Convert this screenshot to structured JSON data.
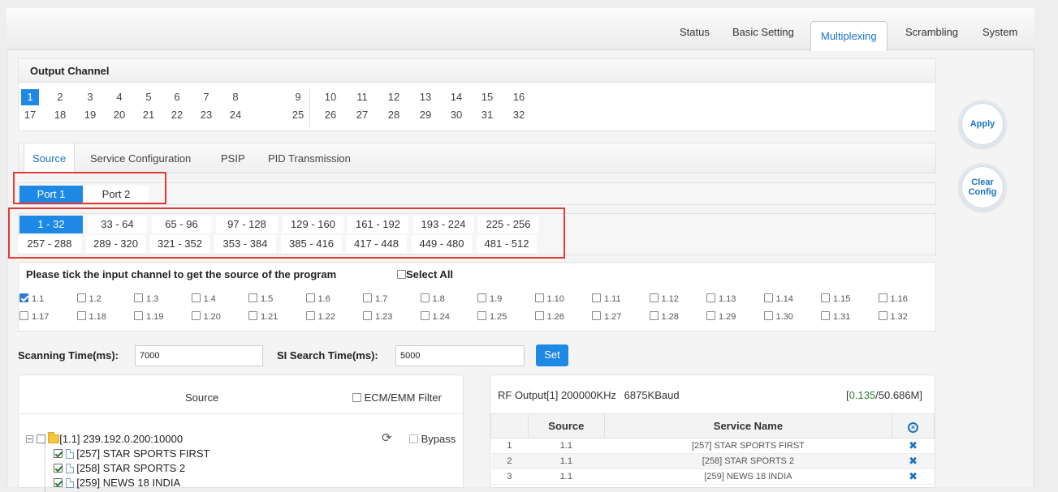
{
  "nav": {
    "tabs": [
      "Status",
      "Basic Setting",
      "Multiplexing",
      "Scrambling",
      "System"
    ],
    "active": "Multiplexing"
  },
  "output_channel": {
    "title": "Output Channel",
    "row1": [
      "1",
      "2",
      "3",
      "4",
      "5",
      "6",
      "7",
      "8",
      "9",
      "10",
      "11",
      "12",
      "13",
      "14",
      "15",
      "16"
    ],
    "row2": [
      "17",
      "18",
      "19",
      "20",
      "21",
      "22",
      "23",
      "24",
      "25",
      "26",
      "27",
      "28",
      "29",
      "30",
      "31",
      "32"
    ],
    "selected": "1"
  },
  "side_buttons": {
    "apply": "Apply",
    "clear": "Clear Config"
  },
  "subtabs": [
    "Source",
    "Service Configuration",
    "PSIP",
    "PID Transmission"
  ],
  "ports": [
    "Port 1",
    "Port 2"
  ],
  "ranges": {
    "row1": [
      "1 - 32",
      "33 - 64",
      "65 - 96",
      "97 - 128",
      "129 - 160",
      "161 - 192",
      "193 - 224",
      "225 - 256"
    ],
    "row2": [
      "257 - 288",
      "289 - 320",
      "321 - 352",
      "353 - 384",
      "385 - 416",
      "417 - 448",
      "449 - 480",
      "481 - 512"
    ]
  },
  "input_channels": {
    "instruction": "Please tick the input channel to get the source of the program",
    "select_all": "Select All",
    "row1": [
      "1.1",
      "1.2",
      "1.3",
      "1.4",
      "1.5",
      "1.6",
      "1.7",
      "1.8",
      "1.9",
      "1.10",
      "1.11",
      "1.12",
      "1.13",
      "1.14",
      "1.15",
      "1.16"
    ],
    "row2": [
      "1.17",
      "1.18",
      "1.19",
      "1.20",
      "1.21",
      "1.22",
      "1.23",
      "1.24",
      "1.25",
      "1.26",
      "1.27",
      "1.28",
      "1.29",
      "1.30",
      "1.31",
      "1.32"
    ],
    "checked": [
      "1.1"
    ]
  },
  "scan": {
    "scanning_label": "Scanning Time(ms):",
    "scanning_value": "7000",
    "si_label": "SI Search Time(ms):",
    "si_value": "5000",
    "set_label": "Set"
  },
  "source_panel": {
    "title": "Source",
    "ecm_filter": "ECM/EMM Filter",
    "root": "[1.1] 239.192.0.200:10000",
    "bypass": "Bypass",
    "items": [
      "[257] STAR SPORTS FIRST",
      "[258] STAR SPORTS 2",
      "[259] NEWS 18 INDIA"
    ]
  },
  "rf_panel": {
    "title": "RF Output[1]",
    "freq": "200000KHz",
    "baud": "6875KBaud",
    "rate_used": "0.135",
    "rate_total": "/50.686M]",
    "rate_open": "[",
    "columns": [
      "",
      "Source",
      "Service Name",
      ""
    ],
    "rows": [
      {
        "n": "1",
        "source": "1.1",
        "name": "[257] STAR SPORTS FIRST"
      },
      {
        "n": "2",
        "source": "1.1",
        "name": "[258] STAR SPORTS 2"
      },
      {
        "n": "3",
        "source": "1.1",
        "name": "[259] NEWS 18 INDIA"
      }
    ]
  },
  "colors": {
    "accent": "#1e88e5",
    "highlight_red": "#e53935",
    "rate_green": "#2e7d32"
  }
}
